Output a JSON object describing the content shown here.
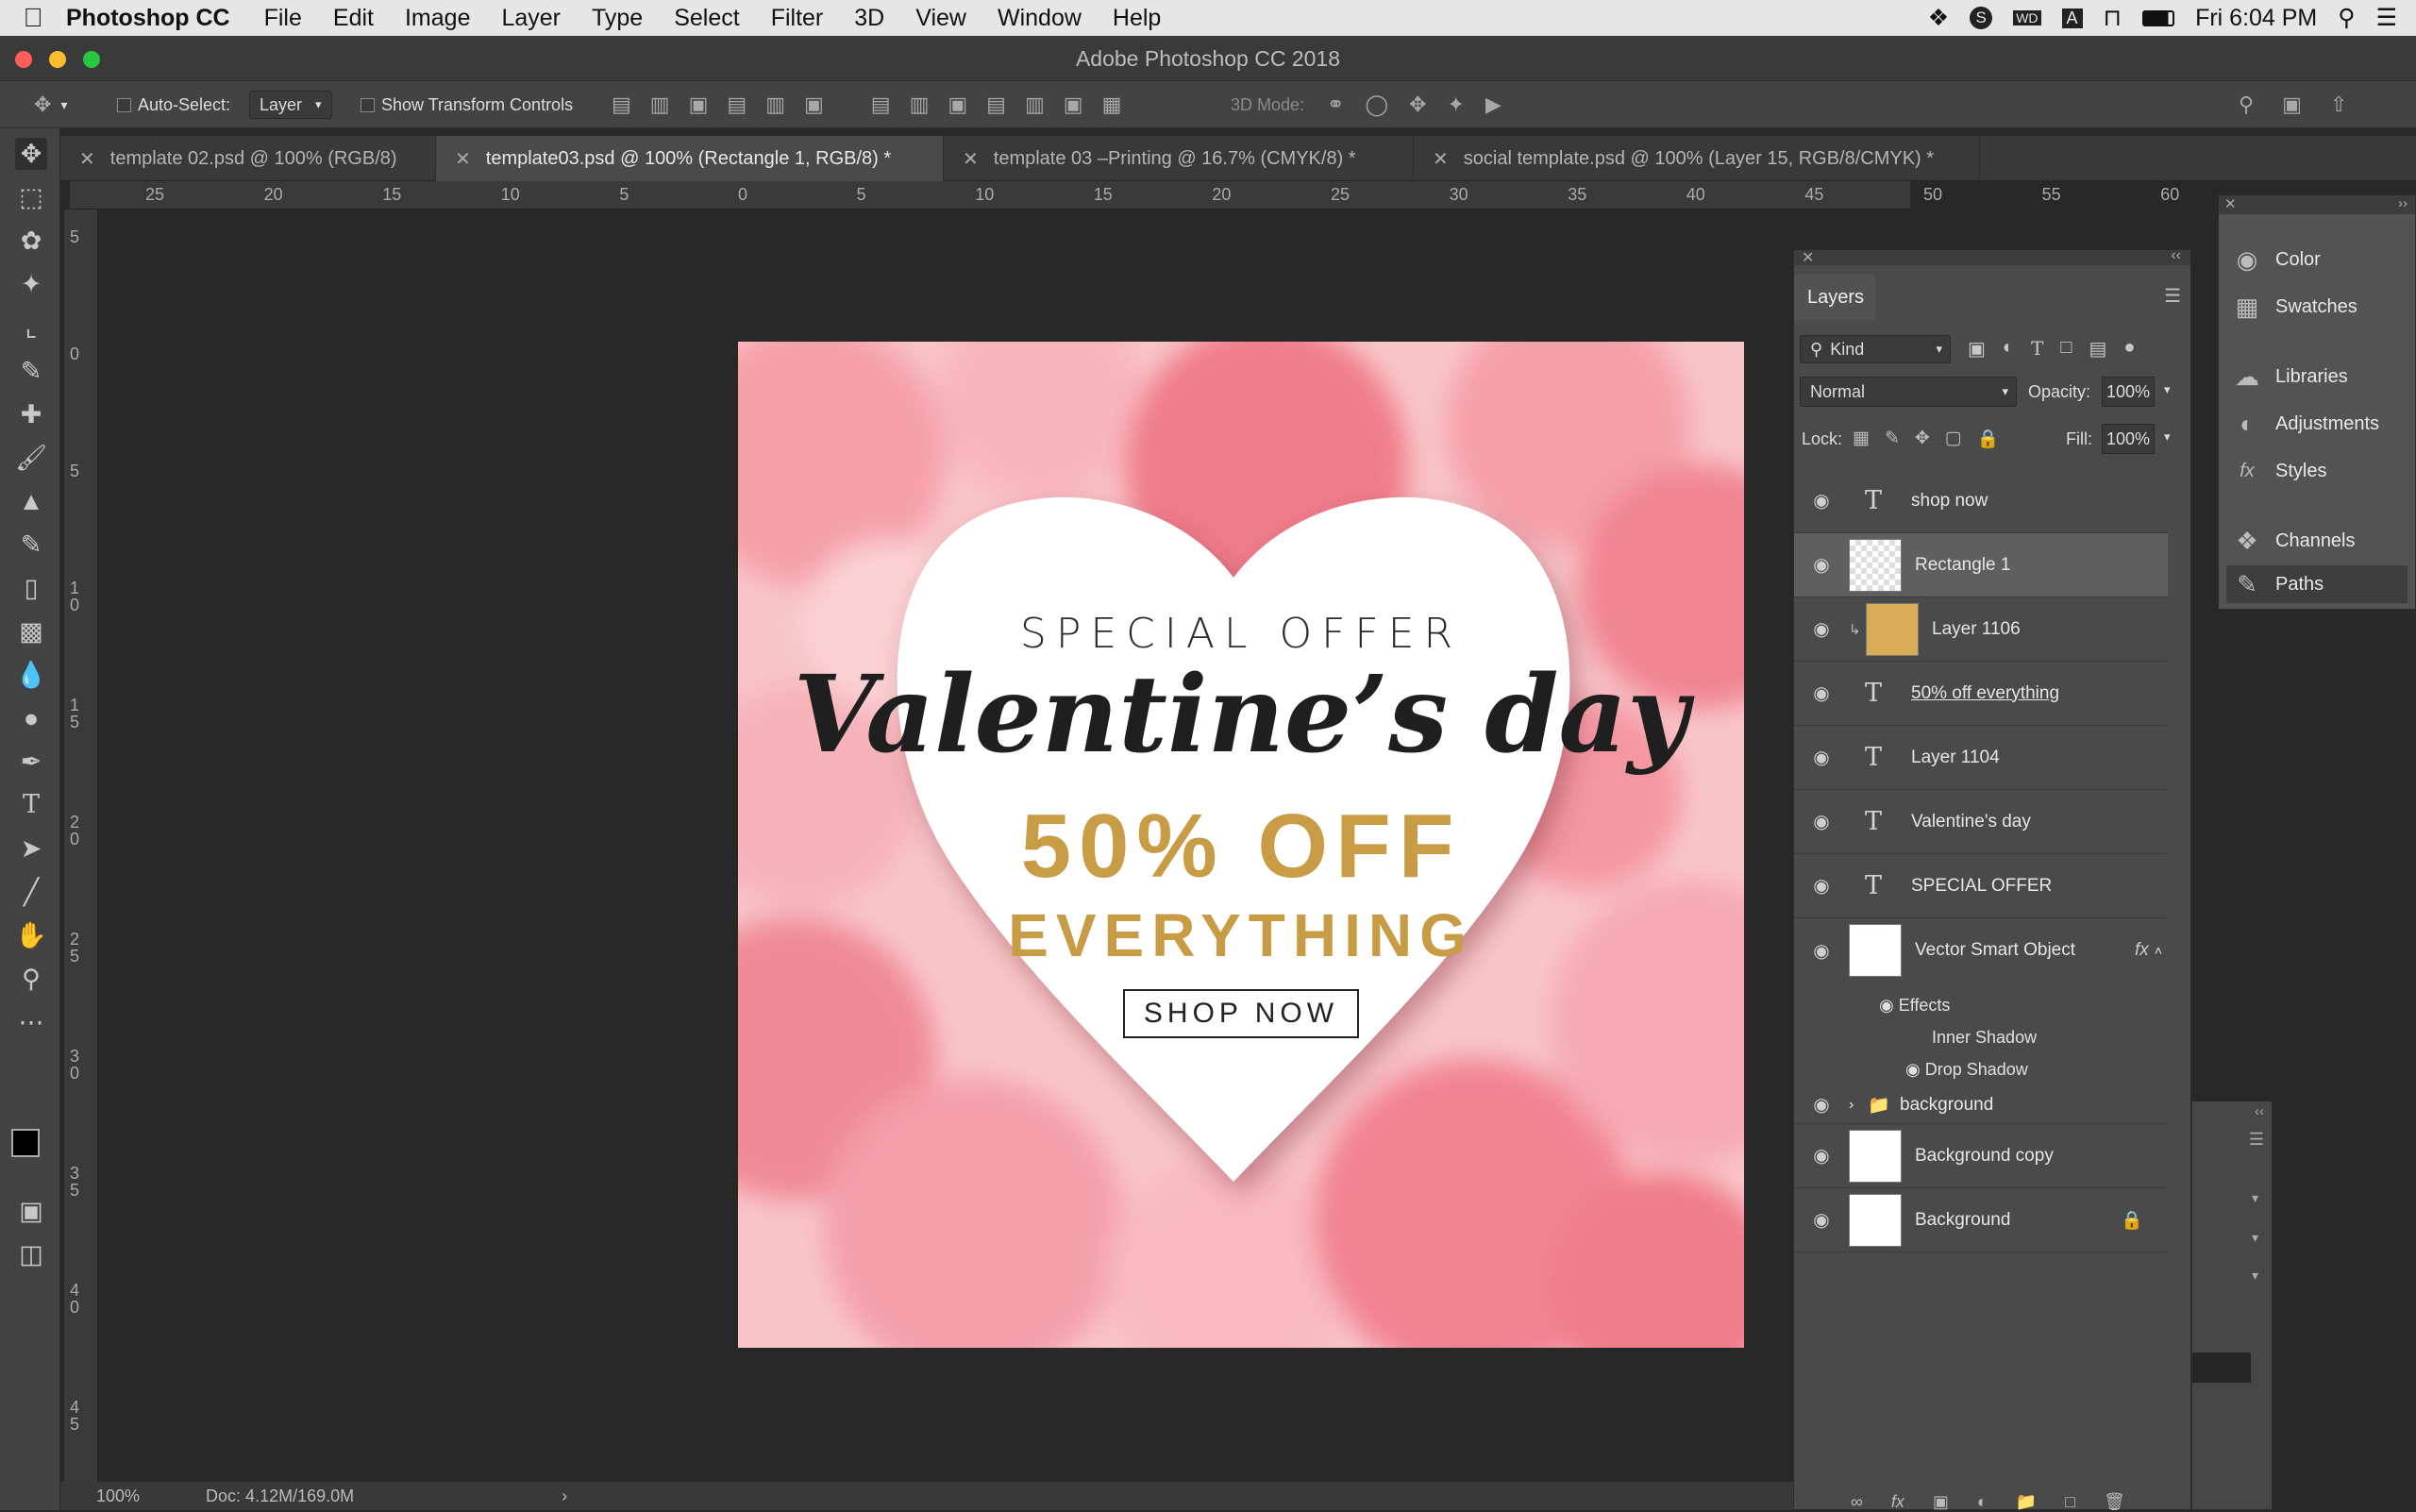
{
  "menubar": {
    "app_name": "Photoshop CC",
    "items": [
      "File",
      "Edit",
      "Image",
      "Layer",
      "Type",
      "Select",
      "Filter",
      "3D",
      "View",
      "Window",
      "Help"
    ],
    "clock": "Fri 6:04 PM"
  },
  "window": {
    "title": "Adobe Photoshop CC 2018"
  },
  "options": {
    "auto_select_label": "Auto-Select:",
    "auto_select_value": "Layer",
    "transform_label": "Show Transform Controls",
    "mode_3d_label": "3D Mode:"
  },
  "tabs": [
    "template 02.psd @ 100% (RGB/8)",
    "template03.psd @ 100% (Rectangle 1, RGB/8) *",
    "template 03 –Printing @ 16.7% (CMYK/8) *",
    "social template.psd @ 100% (Layer 15, RGB/8/CMYK) *"
  ],
  "ruler": {
    "h_labels": [
      "25",
      "20",
      "15",
      "10",
      "5",
      "0",
      "5",
      "10",
      "15",
      "20",
      "25",
      "30",
      "35",
      "40",
      "45",
      "50",
      "55",
      "60"
    ],
    "v_labels": [
      "5",
      "0",
      "5",
      "1\n0",
      "1\n5",
      "2\n0",
      "2\n5",
      "3\n0",
      "3\n5",
      "4\n0",
      "4\n5"
    ]
  },
  "artwork": {
    "special_offer": "SPECIAL OFFER",
    "headline": "Valentine’s day",
    "discount": "50% OFF",
    "everything": "EVERYTHING",
    "cta": "SHOP NOW"
  },
  "status": {
    "zoom": "100%",
    "doc": "Doc: 4.12M/169.0M"
  },
  "layers_panel": {
    "title": "Layers",
    "filter_kind": "Kind",
    "blend_mode": "Normal",
    "opacity_label": "Opacity:",
    "opacity_value": "100%",
    "lock_label": "Lock:",
    "fill_label": "Fill:",
    "fill_value": "100%",
    "layers": [
      {
        "name": "shop now"
      },
      {
        "name": "Rectangle 1"
      },
      {
        "name": "Layer 1106"
      },
      {
        "name": "50% off everything"
      },
      {
        "name": "Layer 1104"
      },
      {
        "name": "Valentine's day"
      },
      {
        "name": "SPECIAL OFFER"
      },
      {
        "name": "Vector Smart Object"
      },
      {
        "name": "background"
      },
      {
        "name": "Background copy"
      },
      {
        "name": "Background"
      }
    ],
    "effects": {
      "label": "Effects",
      "inner": "Inner Shadow",
      "drop": "Drop Shadow"
    }
  },
  "side_panels": [
    "Color",
    "Swatches",
    "Libraries",
    "Adjustments",
    "Styles",
    "Channels",
    "Paths"
  ],
  "colors": {
    "accent_gold": "#c89b45",
    "panel_bg": "#4a4a4a",
    "canvas_bg": "#282828"
  }
}
